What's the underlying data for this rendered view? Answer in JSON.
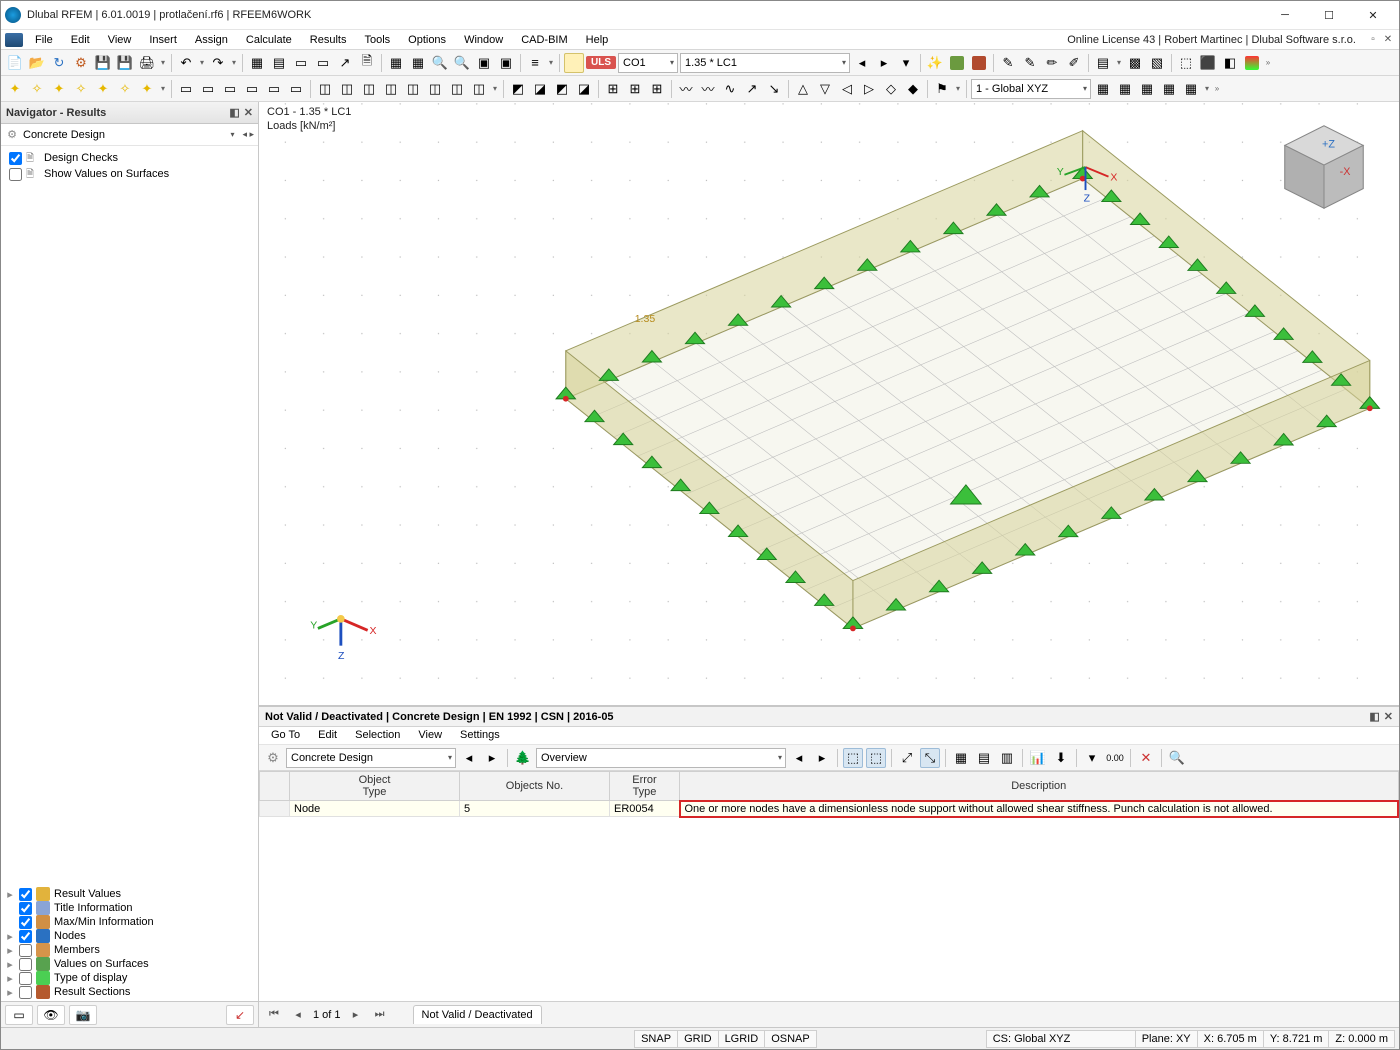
{
  "title": "Dlubal RFEM | 6.01.0019 | protlačení.rf6 | RFEEM6WORK",
  "license": "Online License 43 | Robert Martinec | Dlubal Software s.r.o.",
  "menus": [
    "File",
    "Edit",
    "View",
    "Insert",
    "Assign",
    "Calculate",
    "Results",
    "Tools",
    "Options",
    "Window",
    "CAD-BIM",
    "Help"
  ],
  "tool1": {
    "uls": "ULS",
    "co": "CO1",
    "expr": "1.35 * LC1",
    "cs": "1 - Global XYZ"
  },
  "nav": {
    "title": "Navigator - Results",
    "design": "Concrete Design",
    "items": [
      {
        "label": "Design Checks",
        "checked": true
      },
      {
        "label": "Show Values on Surfaces",
        "checked": false
      }
    ],
    "results": [
      {
        "label": "Result Values",
        "checked": true,
        "expand": true,
        "color": "#e2b33c"
      },
      {
        "label": "Title Information",
        "checked": true,
        "expand": false,
        "color": "#8aa4d6"
      },
      {
        "label": "Max/Min Information",
        "checked": true,
        "expand": false,
        "color": "#d08f45"
      },
      {
        "label": "Nodes",
        "checked": true,
        "expand": true,
        "color": "#2a71c2"
      },
      {
        "label": "Members",
        "checked": false,
        "expand": true,
        "color": "#d6944a"
      },
      {
        "label": "Values on Surfaces",
        "checked": false,
        "expand": true,
        "color": "#58a24f"
      },
      {
        "label": "Type of display",
        "checked": false,
        "expand": true,
        "color": "#4bcf53"
      },
      {
        "label": "Result Sections",
        "checked": false,
        "expand": true,
        "color": "#b55a2e"
      }
    ]
  },
  "viewport": {
    "label": "CO1 - 1.35 * LC1",
    "units": "Loads [kN/m²]",
    "annot": "1.35"
  },
  "lower": {
    "title": "Not Valid / Deactivated | Concrete Design | EN 1992 | CSN | 2016-05",
    "menus": [
      "Go To",
      "Edit",
      "Selection",
      "View",
      "Settings"
    ],
    "combo1": "Concrete Design",
    "combo2": "Overview",
    "headers": {
      "c1": "Object\nType",
      "c2": "Objects No.",
      "c3": "Error\nType",
      "c4": "Description"
    },
    "row": {
      "obj": "Node",
      "no": "5",
      "err": "ER0054",
      "desc": "One or more nodes have a dimensionless node support without allowed shear stiffness. Punch calculation is not allowed."
    },
    "page": "1 of 1",
    "tab": "Not Valid / Deactivated"
  },
  "status": {
    "snap": "SNAP",
    "grid": "GRID",
    "lgrid": "LGRID",
    "osnap": "OSNAP",
    "cs": "CS: Global XYZ",
    "plane": "Plane: XY",
    "x": "X: 6.705 m",
    "y": "Y: 8.721 m",
    "z": "Z: 0.000 m"
  }
}
